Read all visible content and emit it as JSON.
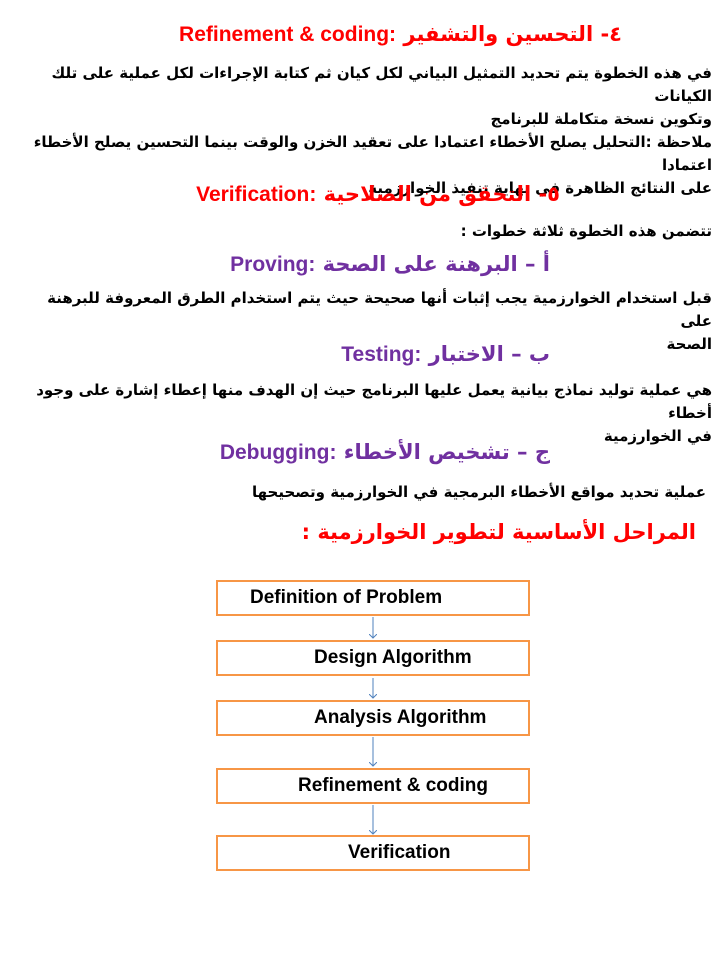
{
  "section4": {
    "heading_ar": "٤- التحسين والتشفير",
    "heading_en": "Refinement & coding:",
    "para1_line1": "في هذه الخطوة يتم تحديد التمثيل البياني لكل كيان ثم كتابة الإجراءات لكل عملية على تلك الكيانات",
    "para1_line2": "وتكوين نسخة متكاملة للبرنامج",
    "note_line1": "ملاحظة :التحليل يصلح الأخطاء اعتمادا على تعقيد الخزن والوقت بينما التحسين يصلح الأخطاء اعتمادا",
    "note_line2": "على النتائج الظاهرة في نهاية تنفيذ الخوارزمية"
  },
  "section5": {
    "heading_ar": "٥- التحقق من الصلاحية",
    "heading_en": "Verification:",
    "intro": "تتضمن هذه الخطوة ثلاثة خطوات :"
  },
  "proving": {
    "heading_ar": "أ – البرهنة على الصحة",
    "heading_en": "Proving:",
    "line1": "قبل استخدام الخوارزمية يجب إثبات أنها صحيحة حيث يتم استخدام الطرق المعروفة للبرهنة على",
    "line2": "الصحة"
  },
  "testing": {
    "heading_ar": "ب – الاختبار",
    "heading_en": "Testing:",
    "line1": "هي عملية توليد نماذج بيانية يعمل عليها البرنامج حيث إن الهدف منها إعطاء إشارة على وجود أخطاء",
    "line2": "في الخوارزمية"
  },
  "debugging": {
    "heading_ar": "ج – تشخيص الأخطاء",
    "heading_en": "Debugging:",
    "line1": "عملية تحديد مواقع الأخطاء البرمجية في الخوارزمية وتصحيحها"
  },
  "stages": {
    "heading": "المراحل الأساسية لتطوير الخوارزمية :",
    "steps": [
      "Definition of Problem",
      "Design Algorithm",
      "Analysis Algorithm",
      "Refinement & coding",
      "Verification"
    ]
  },
  "colors": {
    "red_heading": "#ff0000",
    "purple_heading": "#7030a0",
    "box_border": "#f79646",
    "arrow": "#4f81bd"
  }
}
